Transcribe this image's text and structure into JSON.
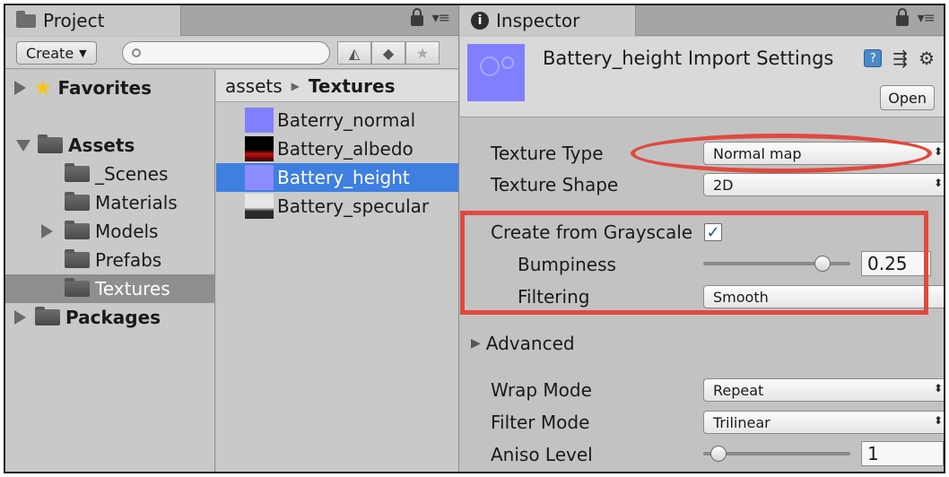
{
  "project": {
    "tab_label": "Project",
    "create_label": "Create",
    "search_placeholder": "",
    "tree": [
      {
        "label": "Favorites"
      },
      {
        "label": "Assets"
      },
      {
        "label": "_Scenes"
      },
      {
        "label": "Materials"
      },
      {
        "label": "Models"
      },
      {
        "label": "Prefabs"
      },
      {
        "label": "Textures"
      },
      {
        "label": "Packages"
      }
    ],
    "breadcrumb": {
      "root": "assets",
      "current": "Textures"
    },
    "files": [
      {
        "label": "Baterry_normal",
        "thumb_color": "#8080ff"
      },
      {
        "label": "Battery_albedo",
        "thumb_color": "#000000"
      },
      {
        "label": "Battery_height",
        "thumb_color": "#8080ff"
      },
      {
        "label": "Battery_specular",
        "thumb_color": "#d4d4d4"
      }
    ]
  },
  "inspector": {
    "tab_label": "Inspector",
    "title": "Battery_height Import Settings",
    "open_label": "Open",
    "texture_type": {
      "label": "Texture Type",
      "value": "Normal map"
    },
    "texture_shape": {
      "label": "Texture Shape",
      "value": "2D"
    },
    "create_from_grayscale": {
      "label": "Create from Grayscale",
      "checked": true
    },
    "bumpiness": {
      "label": "Bumpiness",
      "value": "0.25",
      "slider_fraction": 0.8
    },
    "filtering": {
      "label": "Filtering",
      "value": "Smooth"
    },
    "advanced": {
      "label": "Advanced"
    },
    "wrap_mode": {
      "label": "Wrap Mode",
      "value": "Repeat"
    },
    "filter_mode": {
      "label": "Filter Mode",
      "value": "Trilinear"
    },
    "aniso_level": {
      "label": "Aniso Level",
      "value": "1",
      "slider_fraction": 0.08
    }
  },
  "colors": {
    "annotation": "#e0493f",
    "selection": "#3e7fe0",
    "panel_bg": "#c2c2c2"
  },
  "icons": [
    "folder-icon",
    "lock-icon",
    "menu-icon",
    "search-icon",
    "filter-by-type-icon",
    "label-icon",
    "star-icon",
    "info-icon",
    "help-icon",
    "presets-icon",
    "gear-icon"
  ]
}
